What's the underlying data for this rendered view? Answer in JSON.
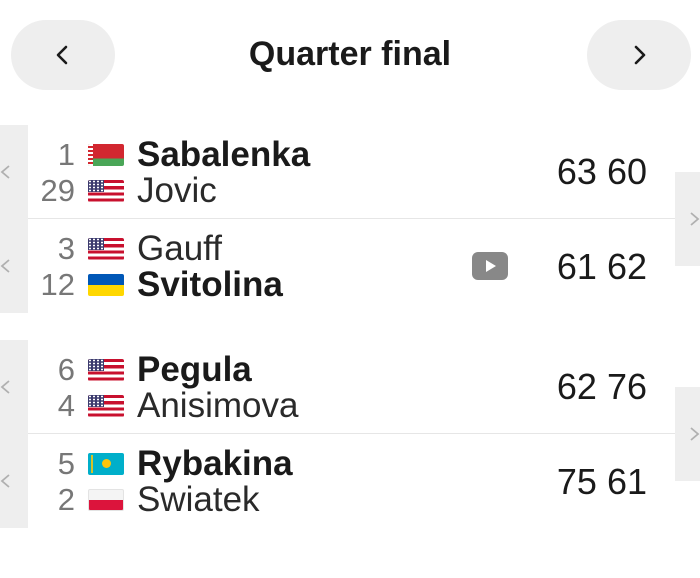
{
  "header": {
    "title": "Quarter final",
    "prev_icon": "chevron-left-icon",
    "next_icon": "chevron-right-icon"
  },
  "colors": {
    "tab_background": "#eeeeee",
    "text": "#1a1a1a",
    "seed_text": "#777777",
    "video_icon": "#888888"
  },
  "matches": [
    {
      "players": [
        {
          "seed": "1",
          "flag": "belarus-flag-icon",
          "name": "Sabalenka",
          "winner": true
        },
        {
          "seed": "29",
          "flag": "usa-flag-icon",
          "name": "Jovic",
          "winner": false
        }
      ],
      "score": "63 60",
      "has_video": false
    },
    {
      "players": [
        {
          "seed": "3",
          "flag": "usa-flag-icon",
          "name": "Gauff",
          "winner": false
        },
        {
          "seed": "12",
          "flag": "ukraine-flag-icon",
          "name": "Svitolina",
          "winner": true
        }
      ],
      "score": "61 62",
      "has_video": true,
      "video_icon": "video-play-icon"
    },
    {
      "players": [
        {
          "seed": "6",
          "flag": "usa-flag-icon",
          "name": "Pegula",
          "winner": true
        },
        {
          "seed": "4",
          "flag": "usa-flag-icon",
          "name": "Anisimova",
          "winner": false
        }
      ],
      "score": "62 76",
      "has_video": false
    },
    {
      "players": [
        {
          "seed": "5",
          "flag": "kazakhstan-flag-icon",
          "name": "Rybakina",
          "winner": true
        },
        {
          "seed": "2",
          "flag": "poland-flag-icon",
          "name": "Swiatek",
          "winner": false
        }
      ],
      "score": "75 61",
      "has_video": false
    }
  ]
}
